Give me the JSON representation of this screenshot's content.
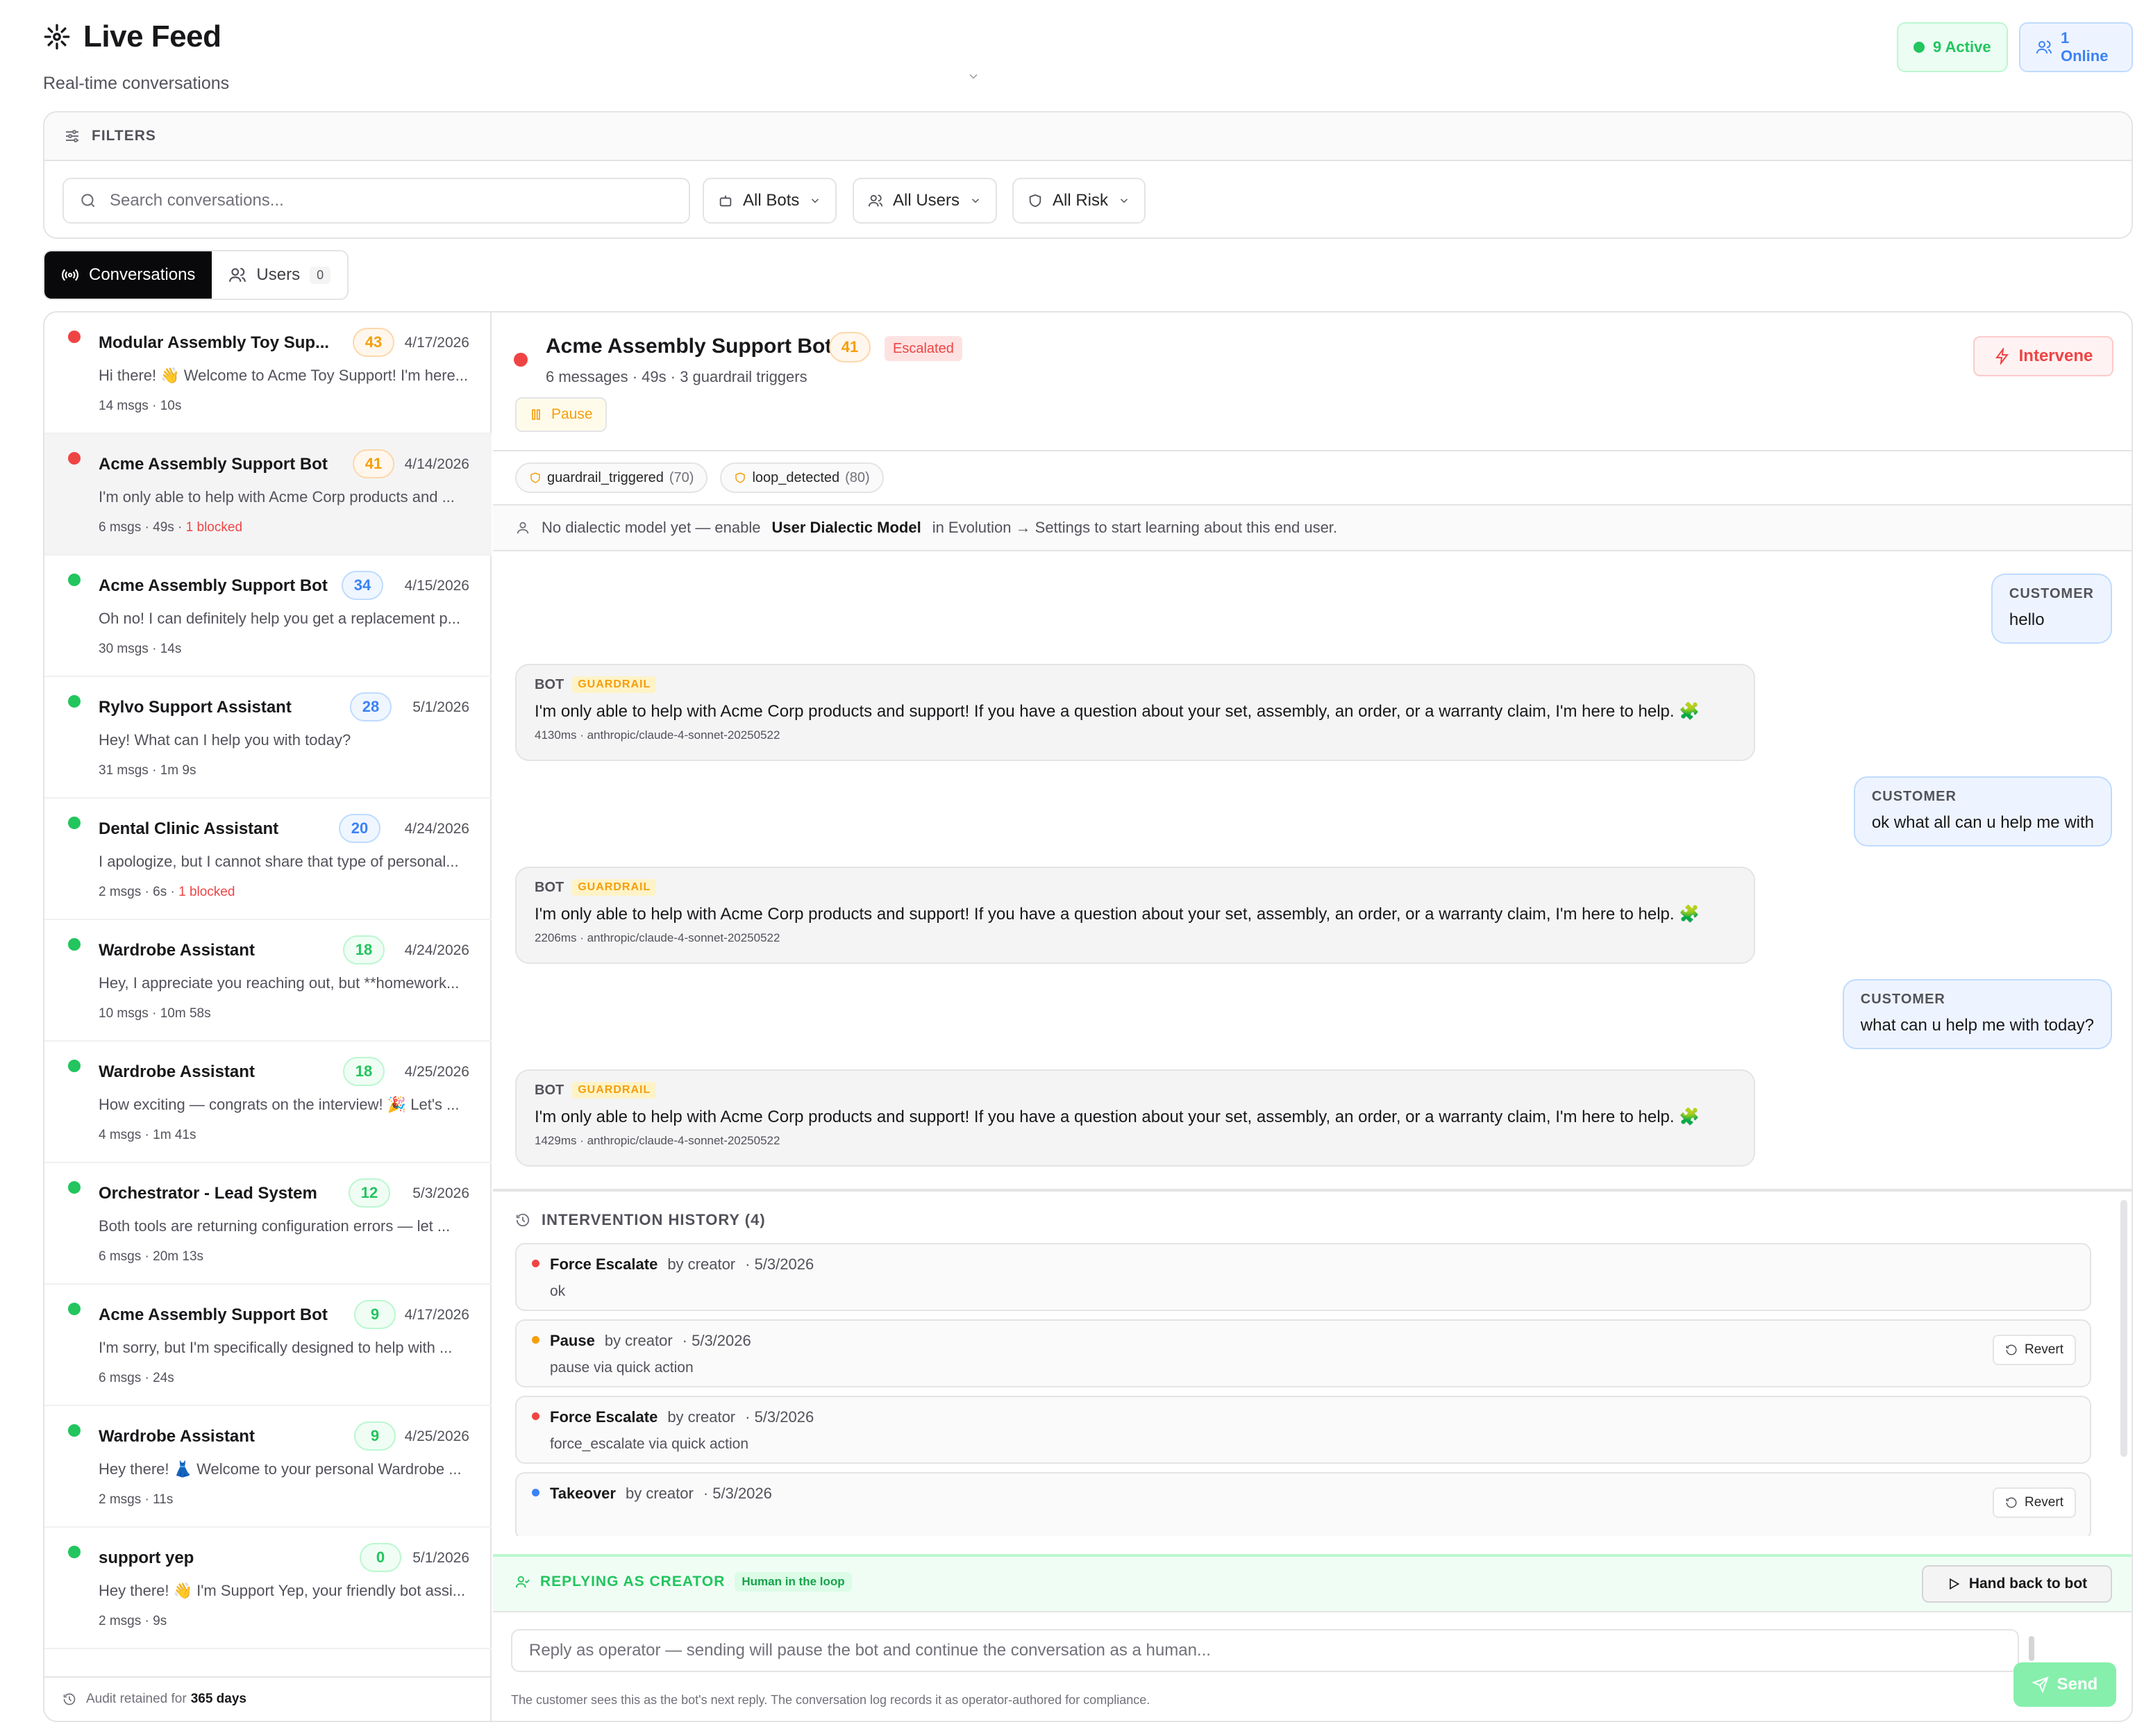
{
  "header": {
    "title": "Live Feed",
    "subtitle": "Real-time conversations",
    "active_label": "9 Active",
    "online_label": "1 Online"
  },
  "filters": {
    "heading": "FILTERS",
    "search_placeholder": "Search conversations...",
    "bots": "All Bots",
    "users": "All Users",
    "risk": "All Risk"
  },
  "tabs": {
    "conversations": "Conversations",
    "users": "Users",
    "users_count": "0"
  },
  "conversations": [
    {
      "title": "Modular Assembly Toy Sup...",
      "score": "43",
      "score_color": "orange",
      "date": "4/17/2026",
      "preview": "Hi there! 👋 Welcome to Acme Toy Support! I'm here...",
      "msgs": "14 msgs",
      "duration": "10s",
      "blocked": "",
      "status": "red"
    },
    {
      "title": "Acme Assembly Support Bot",
      "score": "41",
      "score_color": "orange",
      "date": "4/14/2026",
      "preview": "I'm only able to help with Acme Corp products and ...",
      "msgs": "6 msgs",
      "duration": "49s",
      "blocked": "1 blocked",
      "status": "red"
    },
    {
      "title": "Acme Assembly Support Bot",
      "score": "34",
      "score_color": "blue",
      "date": "4/15/2026",
      "preview": "Oh no! I can definitely help you get a replacement p...",
      "msgs": "30 msgs",
      "duration": "14s",
      "blocked": "",
      "status": "green"
    },
    {
      "title": "Rylvo Support Assistant",
      "score": "28",
      "score_color": "blue",
      "date": "5/1/2026",
      "preview": "Hey! What can I help you with today?",
      "msgs": "31 msgs",
      "duration": "1m 9s",
      "blocked": "",
      "status": "green"
    },
    {
      "title": "Dental Clinic Assistant",
      "score": "20",
      "score_color": "blue",
      "date": "4/24/2026",
      "preview": "I apologize, but I cannot share that type of personal...",
      "msgs": "2 msgs",
      "duration": "6s",
      "blocked": "1 blocked",
      "status": "green"
    },
    {
      "title": "Wardrobe Assistant",
      "score": "18",
      "score_color": "green",
      "date": "4/24/2026",
      "preview": "Hey, I appreciate you reaching out, but **homework...",
      "msgs": "10 msgs",
      "duration": "10m 58s",
      "blocked": "",
      "status": "green"
    },
    {
      "title": "Wardrobe Assistant",
      "score": "18",
      "score_color": "green",
      "date": "4/25/2026",
      "preview": "How exciting — congrats on the interview! 🎉 Let's ...",
      "msgs": "4 msgs",
      "duration": "1m 41s",
      "blocked": "",
      "status": "green"
    },
    {
      "title": "Orchestrator - Lead System",
      "score": "12",
      "score_color": "green",
      "date": "5/3/2026",
      "preview": "Both tools are returning configuration errors — let ...",
      "msgs": "6 msgs",
      "duration": "20m 13s",
      "blocked": "",
      "status": "green"
    },
    {
      "title": "Acme Assembly Support Bot",
      "score": "9",
      "score_color": "green",
      "date": "4/17/2026",
      "preview": "I'm sorry, but I'm specifically designed to help with ...",
      "msgs": "6 msgs",
      "duration": "24s",
      "blocked": "",
      "status": "green"
    },
    {
      "title": "Wardrobe Assistant",
      "score": "9",
      "score_color": "green",
      "date": "4/25/2026",
      "preview": "Hey there! 👗 Welcome to your personal Wardrobe ...",
      "msgs": "2 msgs",
      "duration": "11s",
      "blocked": "",
      "status": "green"
    },
    {
      "title": "support yep",
      "score": "0",
      "score_color": "green",
      "date": "5/1/2026",
      "preview": "Hey there! 👋 I'm Support Yep, your friendly bot assi...",
      "msgs": "2 msgs",
      "duration": "9s",
      "blocked": "",
      "status": "green"
    }
  ],
  "audit": {
    "prefix": "Audit retained for",
    "days": "365 days"
  },
  "detail": {
    "title": "Acme Assembly Support Bot",
    "score": "41",
    "status": "Escalated",
    "summary": "6 messages · 49s · 3 guardrail triggers",
    "pause": "Pause",
    "intervene": "Intervene",
    "tags": [
      {
        "name": "guardrail_triggered",
        "value": "(70)"
      },
      {
        "name": "loop_detected",
        "value": "(80)"
      }
    ],
    "dialect_prefix": "No dialectic model yet — enable",
    "dialect_link": "User Dialectic Model",
    "dialect_suffix": "in Evolution → Settings to start learning about this end user."
  },
  "messages": [
    {
      "role": "CUSTOMER",
      "text": "hello"
    },
    {
      "role": "BOT",
      "badge": "GUARDRAIL",
      "text": "I'm only able to help with Acme Corp products and support! If you have a question about your set, assembly, an order, or a warranty claim, I'm here to help. 🧩",
      "meta": "4130ms · anthropic/claude-4-sonnet-20250522"
    },
    {
      "role": "CUSTOMER",
      "text": "ok what all can u help me with"
    },
    {
      "role": "BOT",
      "badge": "GUARDRAIL",
      "text": "I'm only able to help with Acme Corp products and support! If you have a question about your set, assembly, an order, or a warranty claim, I'm here to help. 🧩",
      "meta": "2206ms · anthropic/claude-4-sonnet-20250522"
    },
    {
      "role": "CUSTOMER",
      "text": "what can u help me with today?"
    },
    {
      "role": "BOT",
      "badge": "GUARDRAIL",
      "text": "I'm only able to help with Acme Corp products and support! If you have a question about your set, assembly, an order, or a warranty claim, I'm here to help. 🧩",
      "meta": "1429ms · anthropic/claude-4-sonnet-20250522"
    }
  ],
  "history": {
    "title": "INTERVENTION HISTORY (4)",
    "items": [
      {
        "action": "Force Escalate",
        "by": "by creator",
        "date": "· 5/3/2026",
        "note": "ok",
        "color": "#ef4444",
        "revert": ""
      },
      {
        "action": "Pause",
        "by": "by creator",
        "date": "· 5/3/2026",
        "note": "pause via quick action",
        "color": "#f59e0b",
        "revert": "Revert"
      },
      {
        "action": "Force Escalate",
        "by": "by creator",
        "date": "· 5/3/2026",
        "note": "force_escalate via quick action",
        "color": "#ef4444",
        "revert": ""
      },
      {
        "action": "Takeover",
        "by": "by creator",
        "date": "· 5/3/2026",
        "note": "",
        "color": "#3b82f6",
        "revert": "Revert"
      }
    ]
  },
  "reply": {
    "label": "REPLYING AS CREATOR",
    "badge": "Human in the loop",
    "hand_back": "Hand back to bot",
    "placeholder": "Reply as operator — sending will pause the bot and continue the conversation as a human...",
    "send": "Send",
    "note": "The customer sees this as the bot's next reply. The conversation log records it as operator-authored for compliance."
  },
  "colors": {
    "red": "#ef4444",
    "green": "#22c55e",
    "orange": "#f59e0b",
    "blue": "#3b82f6"
  }
}
